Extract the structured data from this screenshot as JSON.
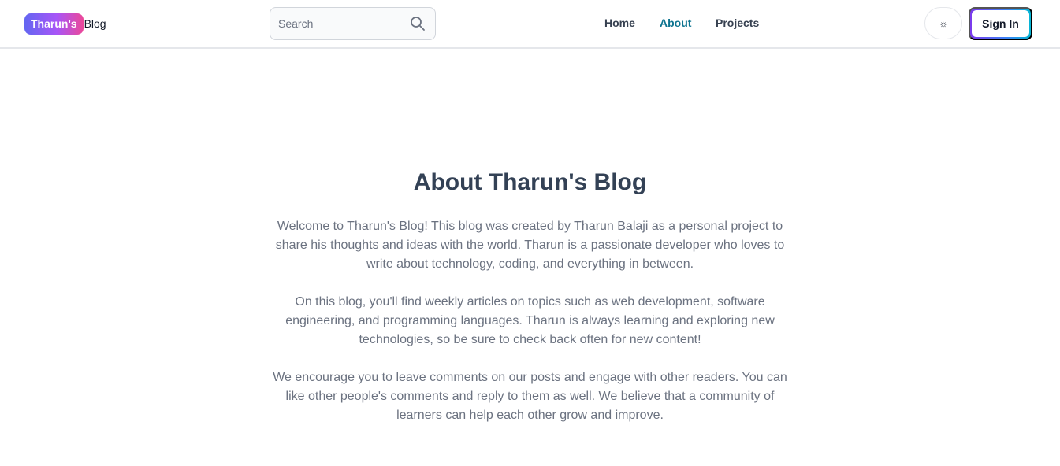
{
  "brand": {
    "badge": "Tharun's",
    "text": "Blog"
  },
  "search": {
    "placeholder": "Search"
  },
  "nav": {
    "home": "Home",
    "about": "About",
    "projects": "Projects"
  },
  "theme_toggle": {
    "icon": "☼"
  },
  "auth": {
    "signin_label": "Sign In"
  },
  "about": {
    "title": "About Tharun's Blog",
    "paragraphs": [
      "Welcome to Tharun's Blog! This blog was created by Tharun Balaji as a personal project to share his thoughts and ideas with the world. Tharun is a passionate developer who loves to write about technology, coding, and everything in between.",
      "On this blog, you'll find weekly articles on topics such as web development, software engineering, and programming languages. Tharun is always learning and exploring new technologies, so be sure to check back often for new content!",
      "We encourage you to leave comments on our posts and engage with other readers. You can like other people's comments and reply to them as well. We believe that a community of learners can help each other grow and improve."
    ]
  },
  "colors": {
    "active_link": "#0e7490",
    "badge_gradient_start": "#6366f1",
    "badge_gradient_end": "#ec4899"
  }
}
